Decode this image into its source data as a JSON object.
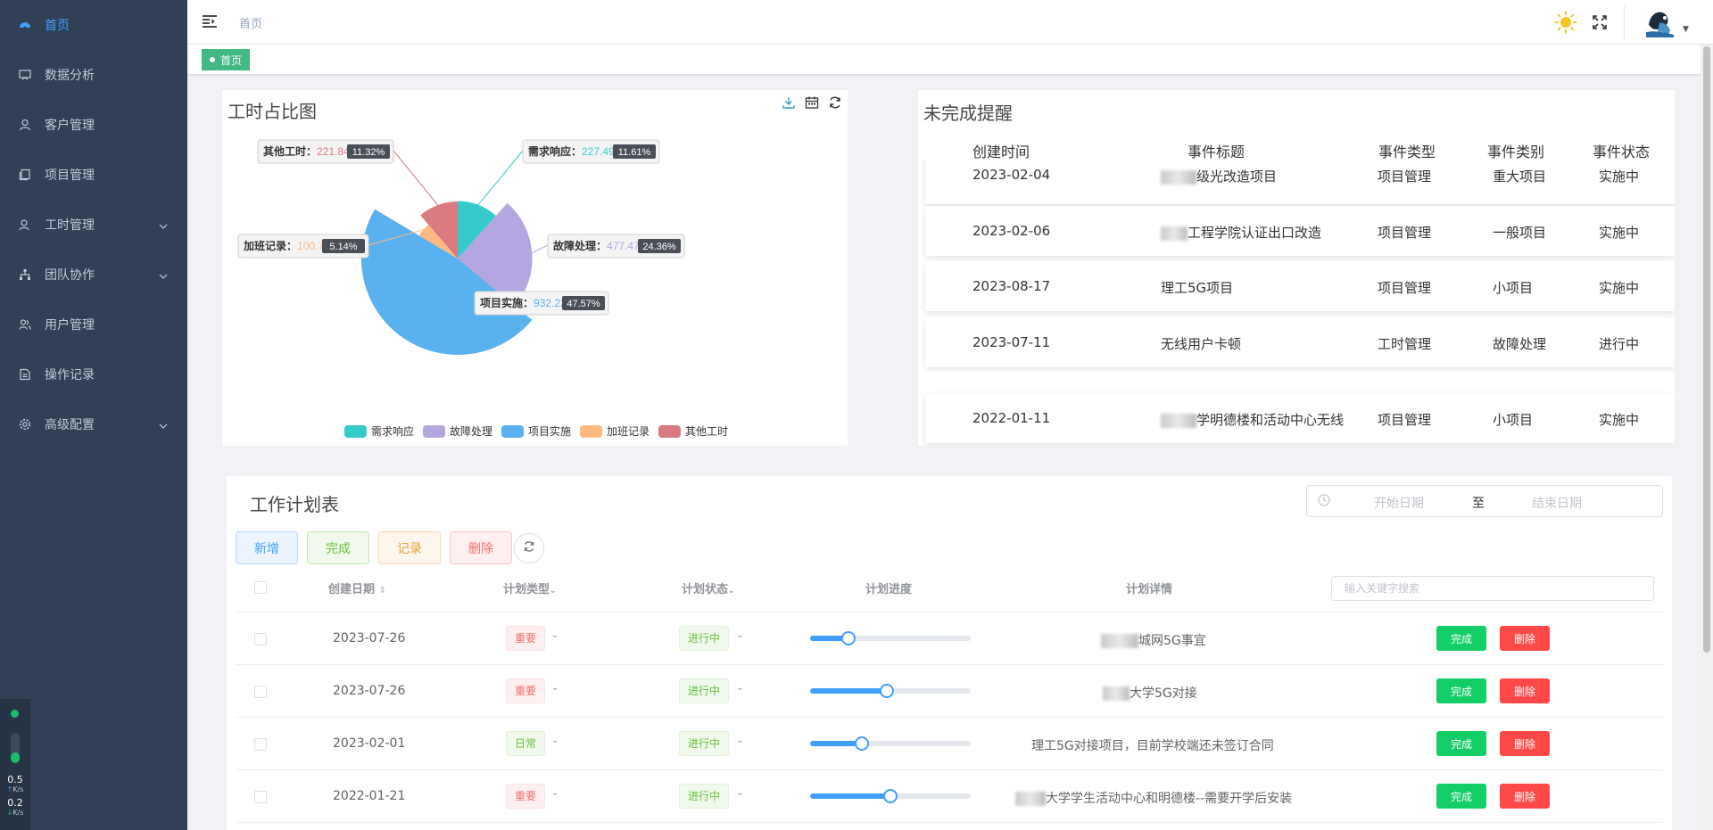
{
  "sidebar": {
    "items": [
      {
        "label": "首页",
        "icon": "dashboard-icon",
        "active": true
      },
      {
        "label": "数据分析",
        "icon": "chart-icon"
      },
      {
        "label": "客户管理",
        "icon": "user-icon"
      },
      {
        "label": "项目管理",
        "icon": "project-icon"
      },
      {
        "label": "工时管理",
        "icon": "worktime-icon",
        "expandable": true
      },
      {
        "label": "团队协作",
        "icon": "team-icon",
        "expandable": true
      },
      {
        "label": "用户管理",
        "icon": "users-icon"
      },
      {
        "label": "操作记录",
        "icon": "log-icon"
      },
      {
        "label": "高级配置",
        "icon": "gear-icon",
        "expandable": true
      }
    ],
    "network": {
      "upload": "0.5",
      "upload_unit": "K/s",
      "download": "0.2",
      "download_unit": "K/s",
      "level": 0.35
    }
  },
  "header": {
    "breadcrumb": "首页",
    "tag": "首页"
  },
  "colors": {
    "sidebar_bg": "#304156",
    "accent": "#409eff",
    "tag_green": "#42b983"
  },
  "pie_panel": {
    "title": "工时占比图",
    "tools": [
      "download-icon",
      "calendar-icon",
      "refresh-icon"
    ]
  },
  "chart_data": {
    "type": "pie",
    "variant": "nightingale-rose",
    "title": "工时占比图",
    "unit": "H",
    "slices": [
      {
        "name": "需求响应",
        "value": 227.49,
        "value_label": "227.49H",
        "percent": "11.61%",
        "color": "#36cbcb"
      },
      {
        "name": "故障处理",
        "value": 477.47,
        "value_label": "477.47H",
        "percent": "24.36%",
        "color": "#b4a7e0"
      },
      {
        "name": "项目实施",
        "value": 932.22,
        "value_label": "932.22H",
        "percent": "47.57%",
        "color": "#5ab1ef"
      },
      {
        "name": "加班记录",
        "value": 100.79,
        "value_label": "100.79H",
        "percent": "5.14%",
        "color": "#ffb980"
      },
      {
        "name": "其他工时",
        "value": 221.84,
        "value_label": "221.84H",
        "percent": "11.32%",
        "color": "#d87a80"
      }
    ],
    "legend": [
      "需求响应",
      "故障处理",
      "项目实施",
      "加班记录",
      "其他工时"
    ],
    "legend_placement": "bottom"
  },
  "reminder_panel": {
    "title": "未完成提醒",
    "columns": [
      "创建时间",
      "事件标题",
      "事件类型",
      "事件类别",
      "事件状态"
    ],
    "rows": [
      {
        "date": "2023-02-04",
        "title": "级光改造项目",
        "type": "项目管理",
        "category": "重大项目",
        "status": "实施中"
      },
      {
        "date": "2023-02-06",
        "title": "工程学院认证出口改造",
        "type": "项目管理",
        "category": "一般项目",
        "status": "实施中"
      },
      {
        "date": "2023-08-17",
        "title": "理工5G项目",
        "type": "项目管理",
        "category": "小项目",
        "status": "实施中"
      },
      {
        "date": "2023-07-11",
        "title": "无线用户卡顿",
        "type": "工时管理",
        "category": "故障处理",
        "status": "进行中"
      },
      {
        "date": "2022-01-11",
        "title": "学明德楼和活动中心无线",
        "type": "项目管理",
        "category": "小项目",
        "status": "实施中"
      }
    ]
  },
  "plan_panel": {
    "title": "工作计划表",
    "date_range": {
      "start_placeholder": "开始日期",
      "separator": "至",
      "end_placeholder": "结束日期"
    },
    "buttons": {
      "add": "新增",
      "done": "完成",
      "record": "记录",
      "delete": "删除"
    },
    "columns": {
      "date": "创建日期",
      "type": "计划类型",
      "status": "计划状态",
      "progress": "计划进度",
      "detail": "计划详情"
    },
    "search_placeholder": "输入关键字搜索",
    "row_actions": {
      "done": "完成",
      "delete": "删除"
    },
    "rows": [
      {
        "date": "2023-07-26",
        "type": "重要",
        "status": "进行中",
        "progress": 0.24,
        "detail": "城网5G事宜"
      },
      {
        "date": "2023-07-26",
        "type": "重要",
        "status": "进行中",
        "progress": 0.48,
        "detail": "大学5G对接"
      },
      {
        "date": "2023-02-01",
        "type": "日常",
        "status": "进行中",
        "progress": 0.32,
        "detail": "理工5G对接项目，目前学校端还未签订合同"
      },
      {
        "date": "2022-01-21",
        "type": "重要",
        "status": "进行中",
        "progress": 0.5,
        "detail": "大学学生活动中心和明德楼--需要开学后安装"
      }
    ]
  }
}
